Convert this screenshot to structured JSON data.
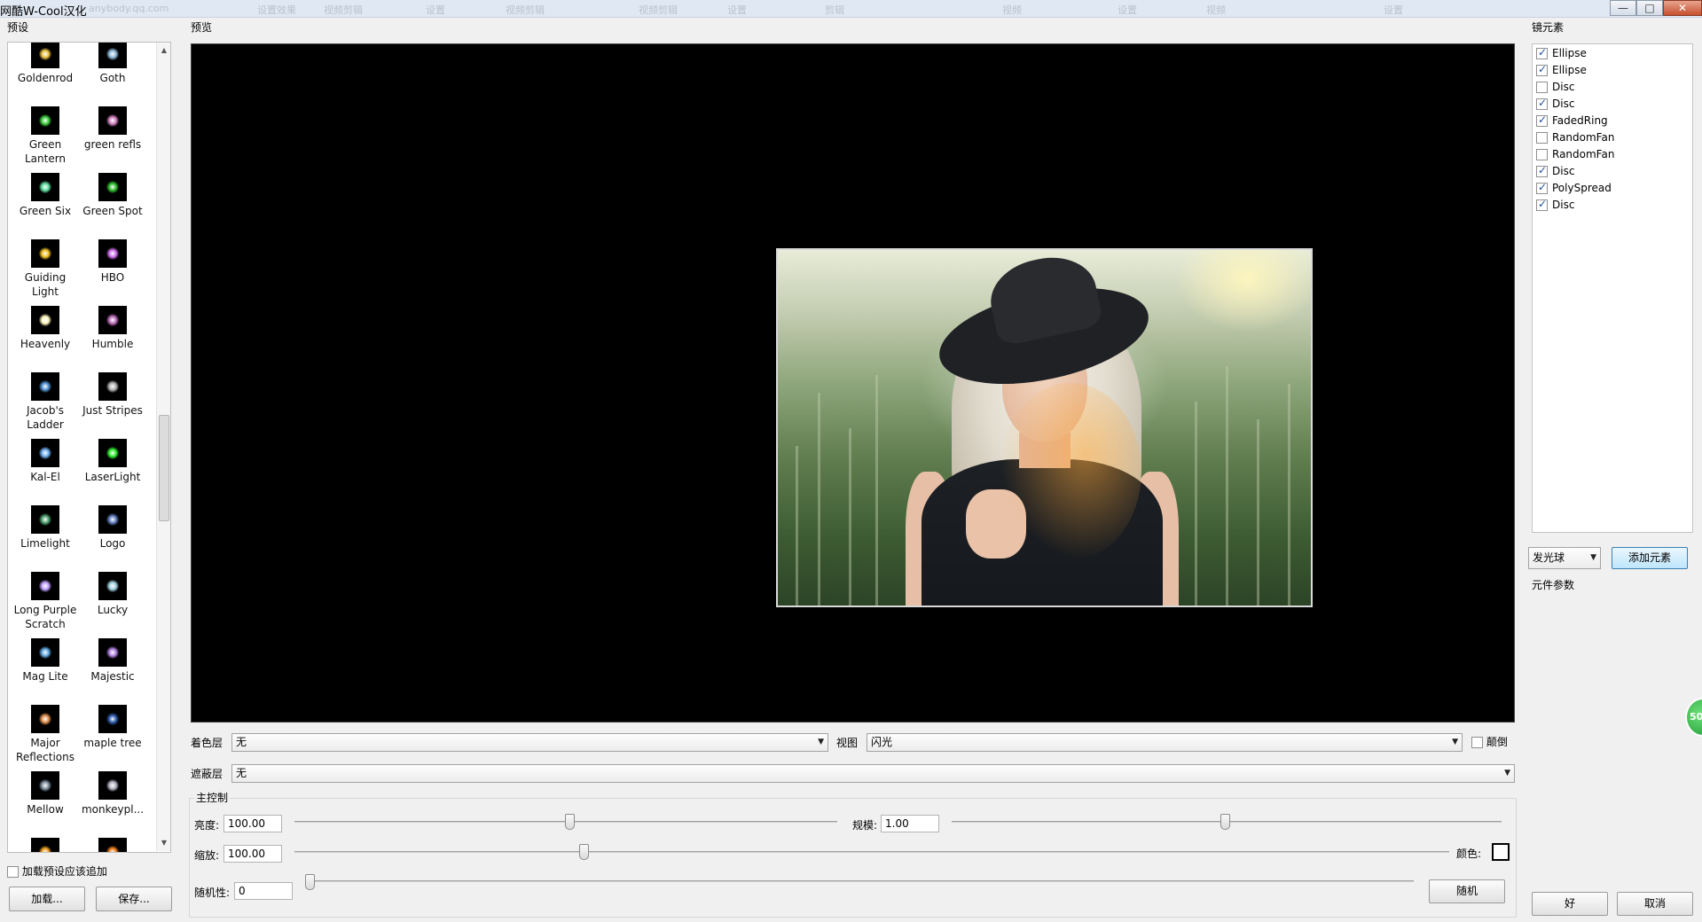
{
  "window": {
    "title": "网酷W-Cool汉化",
    "background_tabs": [
      "anybody.qq.com",
      "设置效果",
      "视频剪辑",
      "设置",
      "视频剪辑",
      "视频剪辑",
      "设置",
      "剪辑",
      "视频",
      "设置",
      "视频",
      "设置"
    ],
    "controls": {
      "minimize": "—",
      "maximize": "□",
      "close": "✕"
    }
  },
  "presets": {
    "label": "预设",
    "items": [
      {
        "name": "Goldenrod",
        "color": "#e8c040"
      },
      {
        "name": "Goth",
        "color": "#8fb8d8"
      },
      {
        "name": "Green Lantern",
        "color": "#40d040"
      },
      {
        "name": "green refls",
        "color": "#d080c0"
      },
      {
        "name": "Green Six",
        "color": "#60e0a0"
      },
      {
        "name": "Green Spot",
        "color": "#30c030"
      },
      {
        "name": "Guiding Light",
        "color": "#f0c020"
      },
      {
        "name": "HBO",
        "color": "#d070f0"
      },
      {
        "name": "Heavenly",
        "color": "#fff8c0"
      },
      {
        "name": "Humble",
        "color": "#c070c0"
      },
      {
        "name": "Jacob's Ladder",
        "color": "#5090d0"
      },
      {
        "name": "Just Stripes",
        "color": "#b0b0b0"
      },
      {
        "name": "Kal-El",
        "color": "#70b0f0"
      },
      {
        "name": "LaserLight",
        "color": "#30f030"
      },
      {
        "name": "Limelight",
        "color": "#50a070"
      },
      {
        "name": "Logo",
        "color": "#6080c0"
      },
      {
        "name": "Long Purple Scratch",
        "color": "#c0a0ff"
      },
      {
        "name": "Lucky",
        "color": "#a0d0e0"
      },
      {
        "name": "Mag Lite",
        "color": "#60a8e0"
      },
      {
        "name": "Majestic",
        "color": "#b080e0"
      },
      {
        "name": "Major Reflections",
        "color": "#e09050"
      },
      {
        "name": "maple tree",
        "color": "#3060b0"
      },
      {
        "name": "Mellow",
        "color": "#8090a0"
      },
      {
        "name": "monkeypl...",
        "color": "#b0b0c0"
      },
      {
        "name": "",
        "color": "#f0a020"
      },
      {
        "name": "",
        "color": "#f08020"
      }
    ],
    "load_append_label": "加载预设应该追加",
    "load_append_checked": false,
    "load_button": "加载...",
    "save_button": "保存..."
  },
  "preview": {
    "label": "预览"
  },
  "controls": {
    "color_layer_label": "着色层",
    "color_layer_value": "无",
    "view_label": "视图",
    "view_value": "闪光",
    "invert_label": "颠倒",
    "invert_checked": false,
    "mask_layer_label": "遮蔽层",
    "mask_layer_value": "无",
    "main_group_label": "主控制",
    "brightness_label": "亮度:",
    "brightness_value": "100.00",
    "scale_label": "规模:",
    "scale_value": "1.00",
    "zoom_label": "缩放:",
    "zoom_value": "100.00",
    "color_label": "颜色:",
    "swatch_color": "#ffffff",
    "randomness_label": "随机性:",
    "randomness_value": "0",
    "random_button": "随机"
  },
  "elements": {
    "label": "镜元素",
    "items": [
      {
        "name": "Ellipse",
        "checked": true
      },
      {
        "name": "Ellipse",
        "checked": true
      },
      {
        "name": "Disc",
        "checked": false
      },
      {
        "name": "Disc",
        "checked": true
      },
      {
        "name": "FadedRing",
        "checked": true
      },
      {
        "name": "RandomFan",
        "checked": false
      },
      {
        "name": "RandomFan",
        "checked": false
      },
      {
        "name": "Disc",
        "checked": true
      },
      {
        "name": "PolySpread",
        "checked": true
      },
      {
        "name": "Disc",
        "checked": true
      }
    ],
    "type_value": "发光球",
    "add_button": "添加元素",
    "params_label": "元件参数"
  },
  "dialog": {
    "ok_button": "好",
    "cancel_button": "取消"
  },
  "badge": {
    "text": "50"
  }
}
